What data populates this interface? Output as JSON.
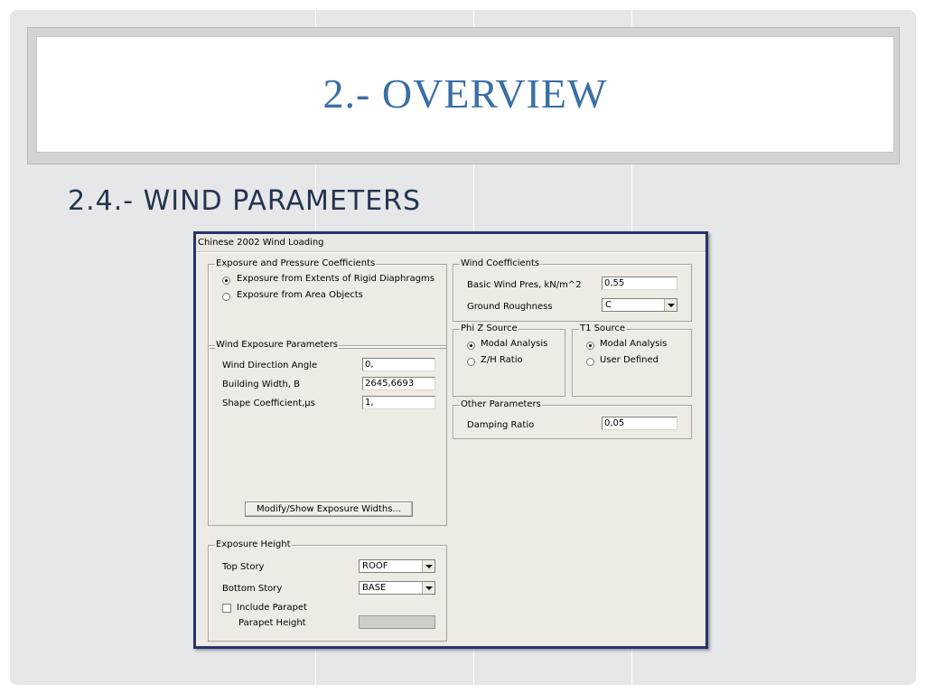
{
  "slide": {
    "title": "2.- OVERVIEW",
    "subtitle": "2.4.- WIND PARAMETERS"
  },
  "dialog": {
    "title": "Chinese 2002   Wind Loading",
    "exposure_pressure": {
      "legend": "Exposure and Pressure Coefficients",
      "options": [
        {
          "label": "Exposure from Extents of Rigid Diaphragms",
          "selected": true
        },
        {
          "label": "Exposure from Area Objects",
          "selected": false
        }
      ]
    },
    "wind_exposure": {
      "legend": "Wind Exposure Parameters",
      "direction_label": "Wind Direction Angle",
      "direction_value": "0,",
      "width_label": "Building Width, B",
      "width_value": "2645,6693",
      "shape_label": "Shape Coefficient,µs",
      "shape_value": "1,",
      "modify_button": "Modify/Show Exposure Widths..."
    },
    "exposure_height": {
      "legend": "Exposure Height",
      "top_label": "Top Story",
      "top_value": "ROOF",
      "bottom_label": "Bottom Story",
      "bottom_value": "BASE",
      "parapet_check_label": "Include Parapet",
      "parapet_checked": false,
      "parapet_height_label": "Parapet Height",
      "parapet_height_value": ""
    },
    "wind_coefficients": {
      "legend": "Wind Coefficients",
      "pressure_label": "Basic Wind Pres, kN/m^2",
      "pressure_value": "0,55",
      "roughness_label": "Ground Roughness",
      "roughness_value": "C"
    },
    "phiz_source": {
      "legend": "Phi Z Source",
      "options": [
        {
          "label": "Modal Analysis",
          "selected": true
        },
        {
          "label": "Z/H Ratio",
          "selected": false
        }
      ]
    },
    "t1_source": {
      "legend": "T1 Source",
      "options": [
        {
          "label": "Modal Analysis",
          "selected": true
        },
        {
          "label": "User Defined",
          "selected": false
        }
      ]
    },
    "other_parameters": {
      "legend": "Other Parameters",
      "damping_label": "Damping Ratio",
      "damping_value": "0,05"
    }
  }
}
